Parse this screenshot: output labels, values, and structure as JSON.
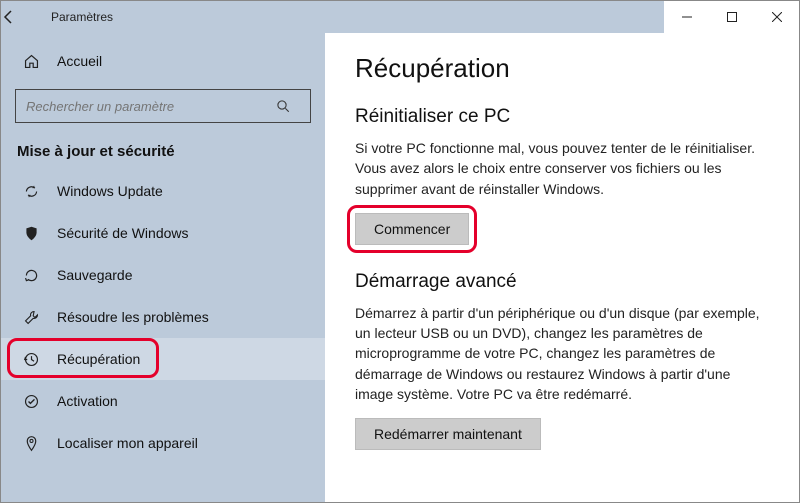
{
  "window": {
    "title": "Paramètres"
  },
  "sidebar": {
    "home": "Accueil",
    "search_placeholder": "Rechercher un paramètre",
    "section": "Mise à jour et sécurité",
    "items": [
      {
        "label": "Windows Update"
      },
      {
        "label": "Sécurité de Windows"
      },
      {
        "label": "Sauvegarde"
      },
      {
        "label": "Résoudre les problèmes"
      },
      {
        "label": "Récupération"
      },
      {
        "label": "Activation"
      },
      {
        "label": "Localiser mon appareil"
      }
    ]
  },
  "content": {
    "title": "Récupération",
    "reset": {
      "heading": "Réinitialiser ce PC",
      "body": "Si votre PC fonctionne mal, vous pouvez tenter de le réinitialiser. Vous avez alors le choix entre conserver vos fichiers ou les supprimer avant de réinstaller Windows.",
      "button": "Commencer"
    },
    "advanced": {
      "heading": "Démarrage avancé",
      "body": "Démarrez à partir d'un périphérique ou d'un disque (par exemple, un lecteur USB ou un DVD), changez les paramètres de microprogramme de votre PC, changez les paramètres de démarrage de Windows ou restaurez Windows à partir d'une image système. Votre PC va être redémarré.",
      "button": "Redémarrer maintenant"
    }
  }
}
